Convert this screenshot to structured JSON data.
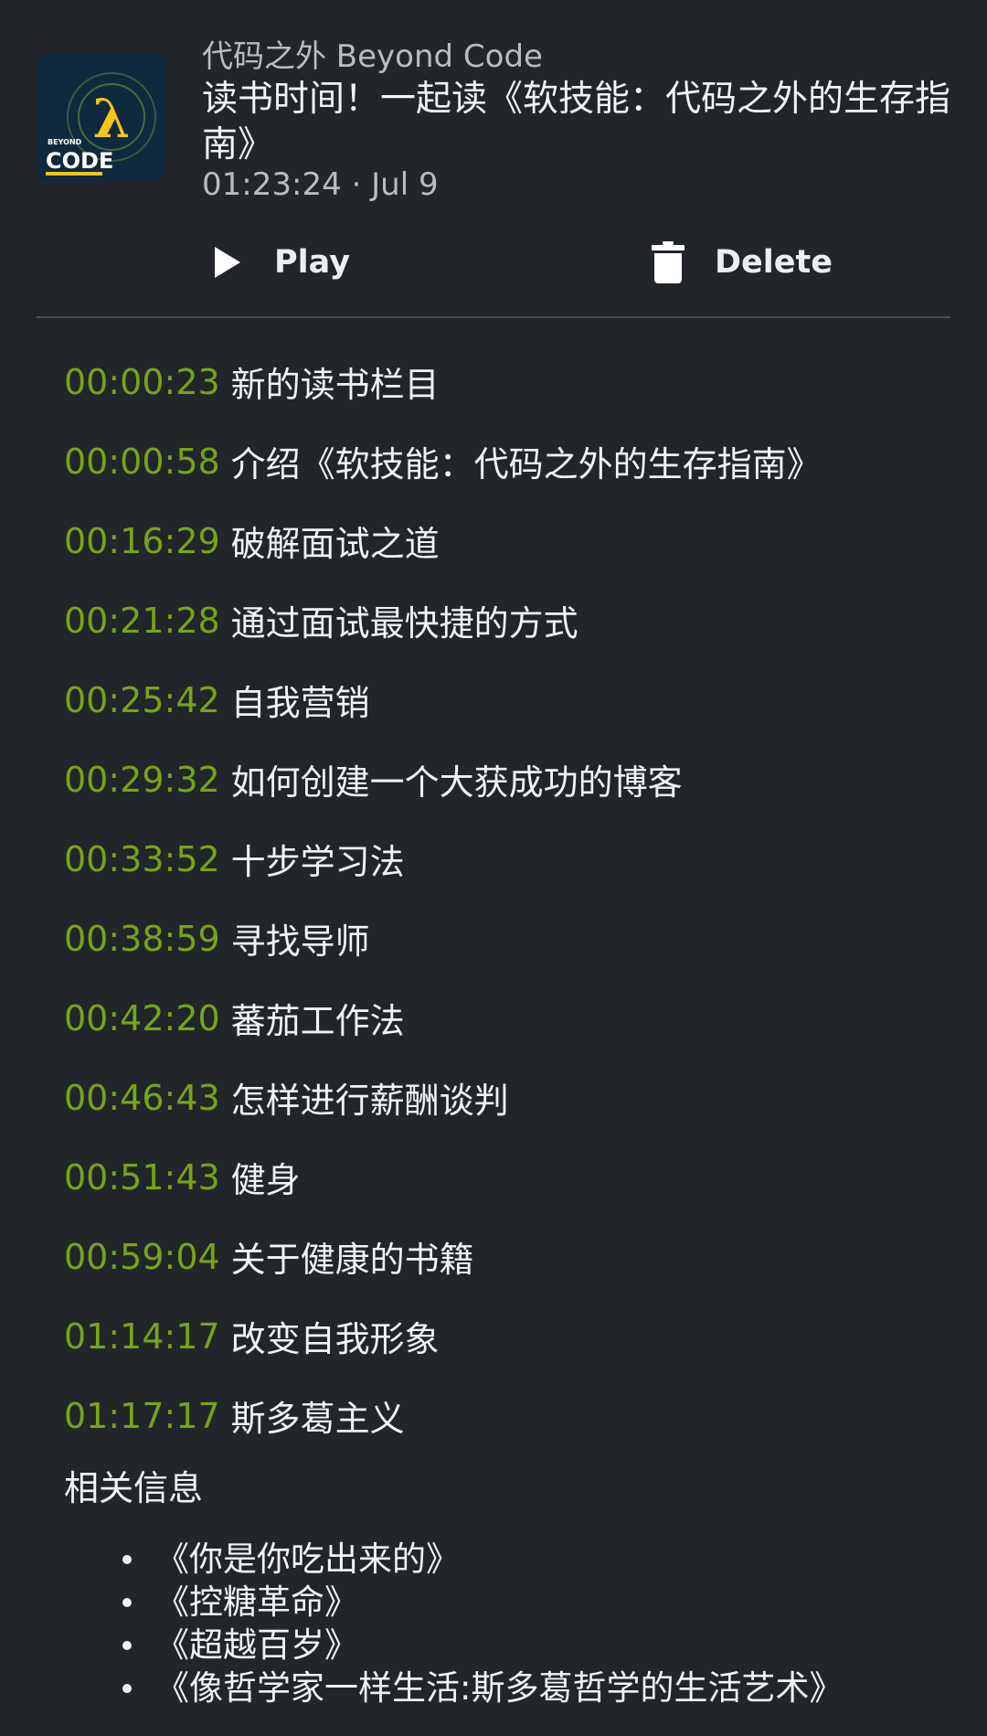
{
  "episode": {
    "podcast_name": "代码之外 Beyond Code",
    "title": "读书时间！一起读《软技能：代码之外的生存指南》",
    "meta": "01:23:24 · Jul 9",
    "artwork_text": "BEYOND CODE"
  },
  "actions": {
    "play_label": "Play",
    "delete_label": "Delete"
  },
  "chapters": [
    {
      "time": "00:00:23",
      "title": "新的读书栏目"
    },
    {
      "time": "00:00:58",
      "title": "介绍《软技能：代码之外的生存指南》"
    },
    {
      "time": "00:16:29",
      "title": "破解面试之道"
    },
    {
      "time": "00:21:28",
      "title": "通过面试最快捷的方式"
    },
    {
      "time": "00:25:42",
      "title": "自我营销"
    },
    {
      "time": "00:29:32",
      "title": "如何创建一个大获成功的博客"
    },
    {
      "time": "00:33:52",
      "title": "十步学习法"
    },
    {
      "time": "00:38:59",
      "title": "寻找导师"
    },
    {
      "time": "00:42:20",
      "title": "蕃茄工作法"
    },
    {
      "time": "00:46:43",
      "title": "怎样进行薪酬谈判"
    },
    {
      "time": "00:51:43",
      "title": "健身"
    },
    {
      "time": "00:59:04",
      "title": "关于健康的书籍"
    },
    {
      "time": "01:14:17",
      "title": "改变自我形象"
    },
    {
      "time": "01:17:17",
      "title": "斯多葛主义"
    }
  ],
  "related": {
    "heading": "相关信息",
    "items": [
      "《你是你吃出来的》",
      "《控糖革命》",
      "《超越百岁》",
      "《像哲学家一样生活:斯多葛哲学的生活艺术》"
    ]
  },
  "colors": {
    "background": "#22252a",
    "timestamp": "#76a515",
    "artwork_bg": "#0f2a3e",
    "artwork_accent": "#f5c518"
  }
}
